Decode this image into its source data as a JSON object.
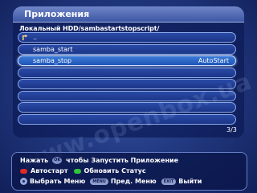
{
  "header": {
    "title": "Приложения"
  },
  "path": "Локальный HDD/sambastartstopscript/",
  "file_list": [
    {
      "label": "..",
      "badge": "",
      "icon": "folder-up-icon",
      "selected": false
    },
    {
      "label": "samba_start",
      "badge": "",
      "icon": "",
      "selected": false
    },
    {
      "label": "samba_stop",
      "badge": "AutoStart",
      "icon": "",
      "selected": true
    },
    {
      "label": "",
      "badge": "",
      "icon": "",
      "selected": false
    },
    {
      "label": "",
      "badge": "",
      "icon": "",
      "selected": false
    },
    {
      "label": "",
      "badge": "",
      "icon": "",
      "selected": false
    },
    {
      "label": "",
      "badge": "",
      "icon": "",
      "selected": false
    },
    {
      "label": "",
      "badge": "",
      "icon": "",
      "selected": false
    }
  ],
  "pager": "3/3",
  "watermark": "www.openbox.ua",
  "footer": {
    "line1": {
      "prefix": "Нажать",
      "key": "OK",
      "text": "чтобы Запустить Приложение"
    },
    "line2": {
      "red_label": "Автостарт",
      "green_label": "Обновить Статус"
    },
    "line3": {
      "nav_label": "Выбрать Меню",
      "menu_key": "MENU",
      "menu_label": "Пред. Меню",
      "exit_key": "EXIT",
      "exit_label": "Выйти"
    }
  },
  "colors": {
    "red_key": "#e02a2a",
    "green_key": "#2fc63a",
    "selected_row": "#2f6ccf"
  }
}
